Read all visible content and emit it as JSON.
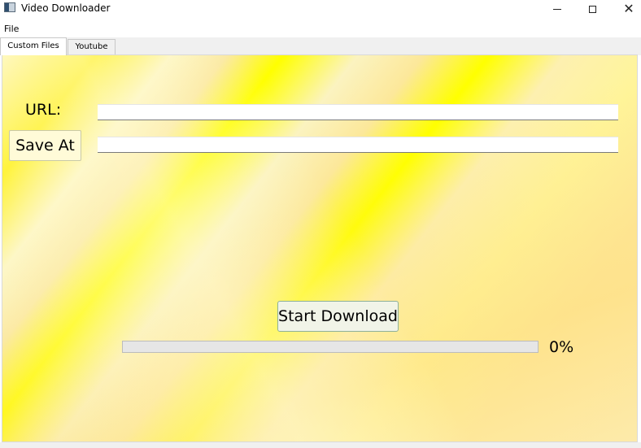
{
  "window": {
    "title": "Video Downloader",
    "icon": "app-window-icon",
    "controls": {
      "minimize": "minimize-icon",
      "maximize": "maximize-icon",
      "close": "close-icon",
      "close_glyph": "✕"
    }
  },
  "menu": {
    "items": [
      {
        "label": "File"
      }
    ]
  },
  "tabs": [
    {
      "label": "Custom Files",
      "active": true
    },
    {
      "label": "Youtube",
      "active": false
    }
  ],
  "form": {
    "url_label": "URL:",
    "url_value": "",
    "save_at_label": "Save At",
    "save_path_value": ""
  },
  "download": {
    "button_label": "Start Download",
    "progress_percent": 0,
    "progress_text": "0%"
  },
  "colors": {
    "background_gradient": [
      "#ffff00",
      "#fdf0b0",
      "#fce89a"
    ],
    "save_button": "#fffbd8",
    "start_button": "#f1f4e8",
    "progress_track": "#e6e6e6",
    "progress_fill": "#06b025"
  }
}
